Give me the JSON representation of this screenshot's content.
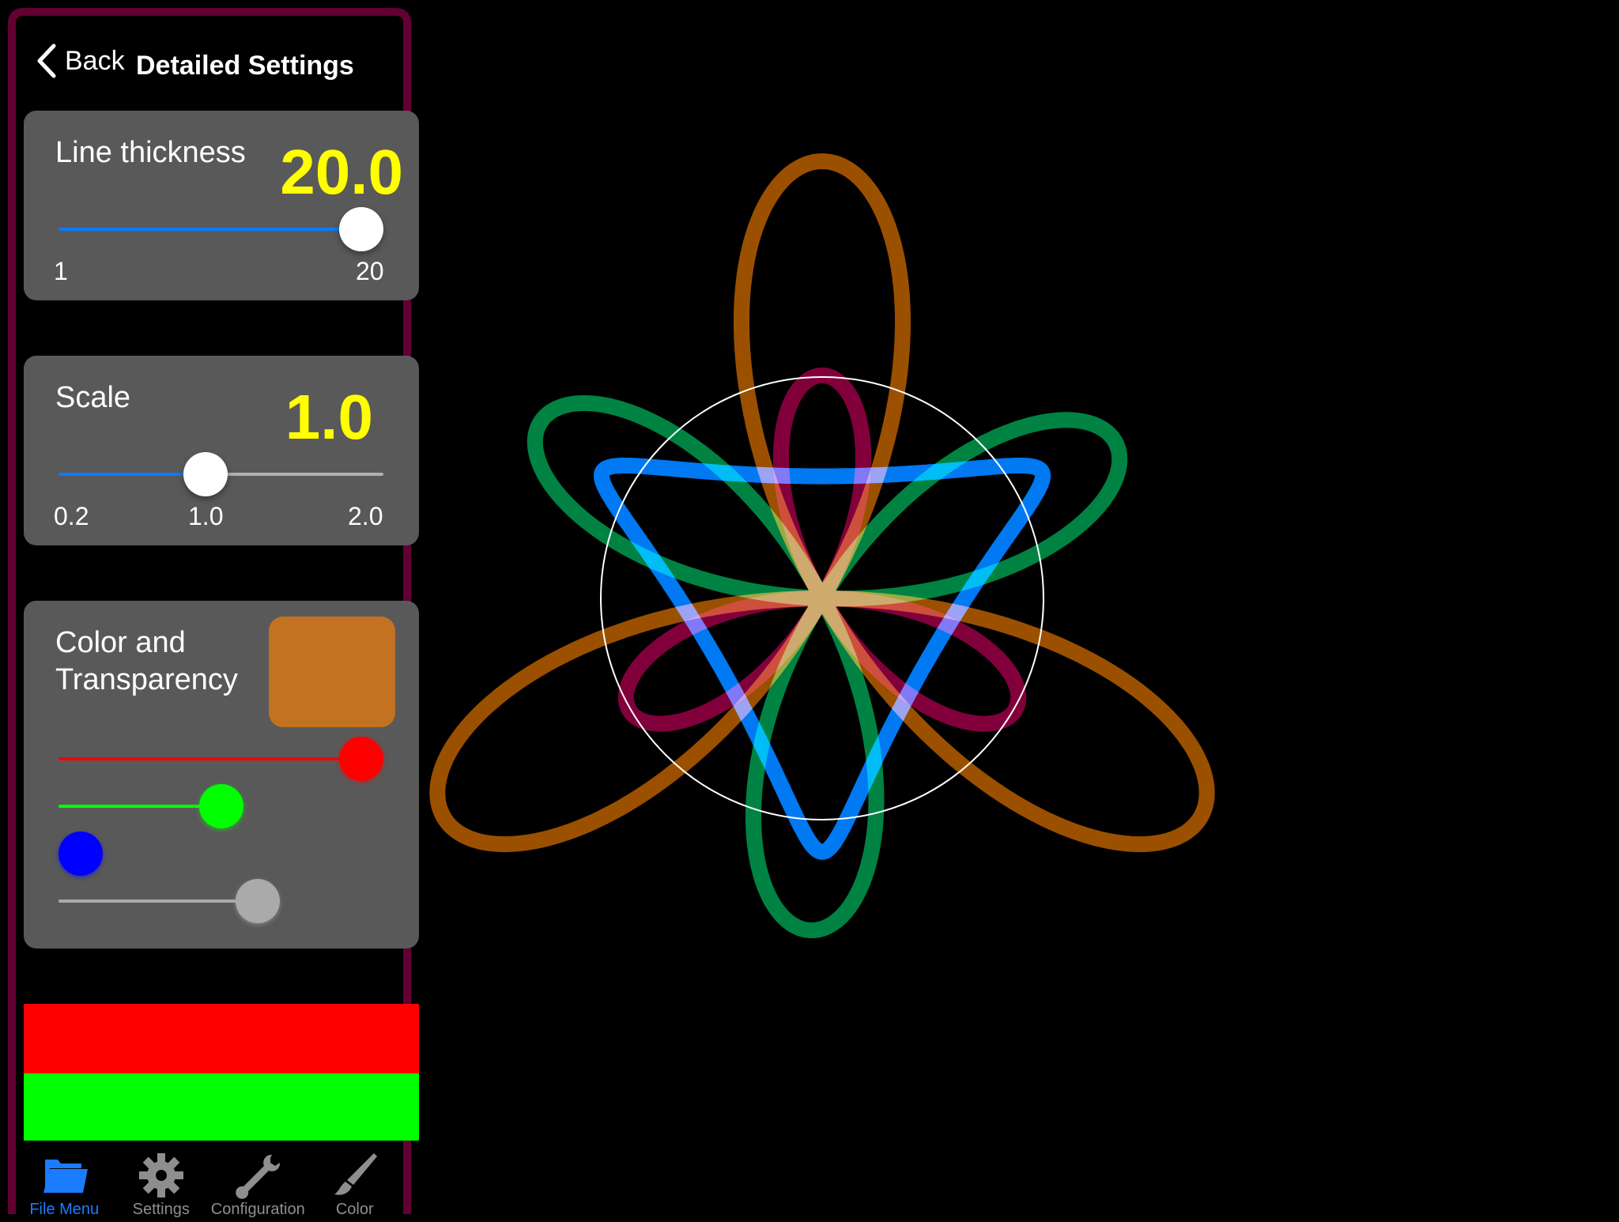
{
  "header": {
    "back_label": "Back",
    "title": "Detailed Settings"
  },
  "line_thickness": {
    "label": "Line thickness",
    "value_text": "20.0",
    "value": 20.0,
    "min": 1,
    "max": 20,
    "min_label": "1",
    "max_label": "20",
    "track_color": "#0a7aff"
  },
  "scale": {
    "label": "Scale",
    "value_text": "1.0",
    "value": 1.0,
    "min": 0.2,
    "max": 2.0,
    "min_label": "0.2",
    "mid_label": "1.0",
    "max_label": "2.0",
    "track_color": "#0a7aff"
  },
  "color": {
    "label_line1": "Color and",
    "label_line2": "Transparency",
    "swatch_color": "#c27221",
    "red": 1.0,
    "green": 0.5,
    "blue": 0.0,
    "alpha": 0.63,
    "red_color": "#ff0000",
    "green_color": "#00ff00",
    "blue_color": "#0000ff",
    "alpha_color": "#aaaaaa"
  },
  "color_bars": [
    "#ff0000",
    "#00ff00"
  ],
  "tabs": [
    {
      "label": "File Menu",
      "icon": "folder-icon",
      "active": true
    },
    {
      "label": "Settings",
      "icon": "gear-icon",
      "active": false
    },
    {
      "label": "Configuration",
      "icon": "wrench-icon",
      "active": false
    },
    {
      "label": "Color",
      "icon": "paintbrush-icon",
      "active": false
    }
  ],
  "theme": {
    "panel_border": "#630033",
    "card_bg": "#595959",
    "value_color": "#ffff00",
    "tab_active": "#1a7cff",
    "tab_inactive": "#8e8e8e"
  },
  "drawing": {
    "curves": [
      {
        "name": "orange-rose",
        "color": "#a35400",
        "type": "rose",
        "petals": 3,
        "size": 1.0,
        "rotation_deg": 90
      },
      {
        "name": "magenta-rose",
        "color": "#88003f",
        "type": "rose",
        "petals": 3,
        "size": 0.51,
        "rotation_deg": 90
      },
      {
        "name": "green-rose",
        "color": "#008a45",
        "type": "rose",
        "petals": 3,
        "size": 0.76,
        "rotation_deg": 28
      },
      {
        "name": "blue-triangle",
        "color": "#0080ff",
        "type": "hypotrochoid",
        "size": 0.58,
        "rotation_deg": 30
      }
    ],
    "guide_circle_color": "#ffffff"
  }
}
